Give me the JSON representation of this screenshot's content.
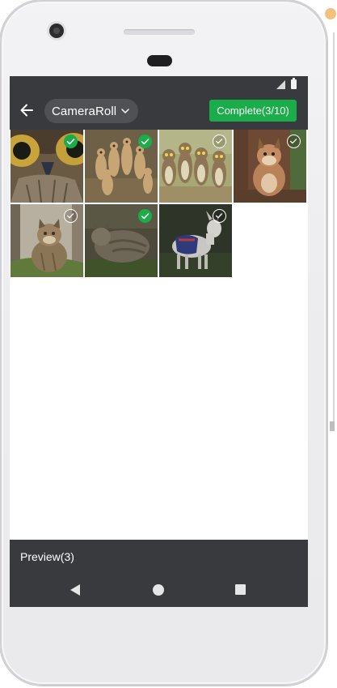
{
  "app": {
    "album_selector": {
      "label": "CameraRoll",
      "icon": "chevron-down-icon"
    },
    "back_icon": "arrow-left-icon",
    "complete_button": {
      "label": "Complete(3/10)",
      "selected_count": 3,
      "max_count": 10
    },
    "photos": [
      {
        "subject": "owl close-up",
        "selected": true
      },
      {
        "subject": "meerkats",
        "selected": true
      },
      {
        "subject": "burrowing owls",
        "selected": false
      },
      {
        "subject": "lynx",
        "selected": false
      },
      {
        "subject": "wild cat",
        "selected": false
      },
      {
        "subject": "wildcat in grass",
        "selected": true
      },
      {
        "subject": "goat with blanket",
        "selected": false
      }
    ],
    "preview_button": {
      "label": "Preview(3)"
    },
    "nav_bar": {
      "back_icon": "triangle-back-icon",
      "home_icon": "circle-home-icon",
      "recents_icon": "square-recents-icon"
    }
  },
  "colors": {
    "toolbar": "#393a3e",
    "accent_green": "#1aad4a",
    "pill": "#505155",
    "screen_bg": "#ffffff"
  }
}
